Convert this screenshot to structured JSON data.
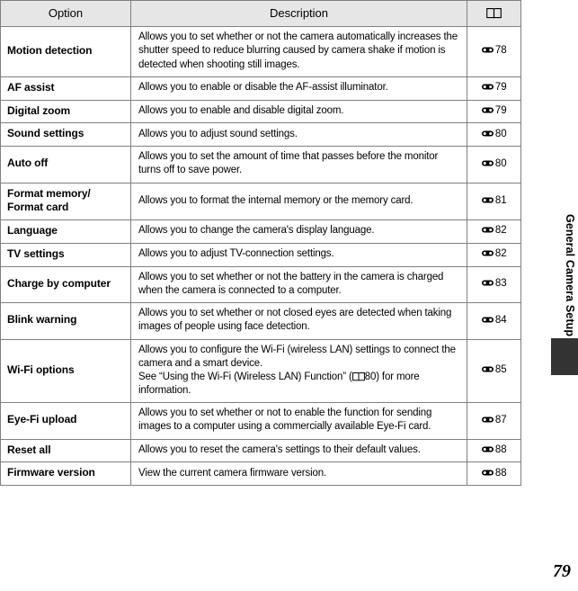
{
  "document": {
    "page_number": "79",
    "side_tab_label": "General Camera Setup"
  },
  "table": {
    "headers": {
      "option": "Option",
      "description": "Description",
      "reference": "book-icon"
    },
    "rows": [
      {
        "option": "Motion detection",
        "description": "Allows you to set whether or not the camera automatically increases the shutter speed to reduce blurring caused by camera shake if motion is detected when shooting still images.",
        "ref_page": "78"
      },
      {
        "option": "AF assist",
        "description": "Allows you to enable or disable the AF-assist illuminator.",
        "ref_page": "79"
      },
      {
        "option": "Digital zoom",
        "description": "Allows you to enable and disable digital zoom.",
        "ref_page": "79"
      },
      {
        "option": "Sound settings",
        "description": "Allows you to adjust sound settings.",
        "ref_page": "80"
      },
      {
        "option": "Auto off",
        "description": "Allows you to set the amount of time that passes before the monitor turns off to save power.",
        "ref_page": "80"
      },
      {
        "option": "Format memory/\nFormat card",
        "description": "Allows you to format the internal memory or the memory card.",
        "ref_page": "81"
      },
      {
        "option": "Language",
        "description": "Allows you to change the camera's display language.",
        "ref_page": "82"
      },
      {
        "option": "TV settings",
        "description": "Allows you to adjust TV-connection settings.",
        "ref_page": "82"
      },
      {
        "option": "Charge by computer",
        "description": "Allows you to set whether or not the battery in the camera is charged when the camera is connected to a computer.",
        "ref_page": "83"
      },
      {
        "option": "Blink warning",
        "description": "Allows you to set whether or not closed eyes are detected when taking images of people using face detection.",
        "ref_page": "84"
      },
      {
        "option": "Wi-Fi options",
        "description_part1": "Allows you to configure the Wi-Fi (wireless LAN) settings to connect the camera and a smart device.",
        "description_part2_before_icon": "See “Using the Wi-Fi (Wireless LAN) Function” (",
        "description_inline_ref_page": "80",
        "description_part2_after_icon": ") for more information.",
        "ref_page": "85"
      },
      {
        "option": "Eye-Fi upload",
        "description": "Allows you to set whether or not to enable the function for sending images to a computer using a commercially available Eye-Fi card.",
        "ref_page": "87"
      },
      {
        "option": "Reset all",
        "description": "Allows you to reset the camera's settings to their default values.",
        "ref_page": "88"
      },
      {
        "option": "Firmware version",
        "description": "View the current camera firmware version.",
        "ref_page": "88"
      }
    ]
  },
  "colors": {
    "header_background": "#e6e6e6",
    "border": "#808080",
    "side_tab_marker": "#333333",
    "text": "#000000"
  }
}
